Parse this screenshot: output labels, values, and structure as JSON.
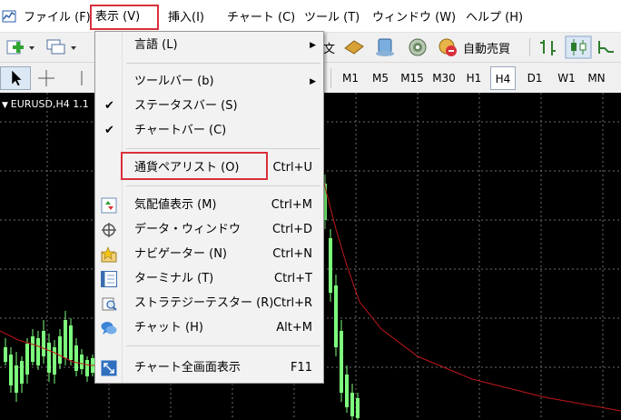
{
  "menubar": {
    "items": [
      "ファイル (F)",
      "表示 (V)",
      "挿入(I)",
      "チャート (C)",
      "ツール (T)",
      "ウィンドウ (W)",
      "ヘルプ (H)"
    ]
  },
  "toolbar1": {
    "text_label": "文",
    "auto_trading_label": "自動売買"
  },
  "timeframes": [
    "M1",
    "M5",
    "M15",
    "M30",
    "H1",
    "H4",
    "D1",
    "W1",
    "MN"
  ],
  "active_timeframe": "H4",
  "chart": {
    "title": "EURUSD,H4  1.1"
  },
  "view_menu": {
    "items": [
      {
        "label": "言語 (L)",
        "shortcut": "",
        "submenu": true,
        "checked": false,
        "icon": ""
      },
      {
        "label": "ツールバー (b)",
        "shortcut": "",
        "submenu": true,
        "checked": false,
        "icon": ""
      },
      {
        "label": "ステータスバー (S)",
        "shortcut": "",
        "submenu": false,
        "checked": true,
        "icon": ""
      },
      {
        "label": "チャートバー (C)",
        "shortcut": "",
        "submenu": false,
        "checked": true,
        "icon": ""
      },
      {
        "label": "通貨ペアリスト (O)",
        "shortcut": "Ctrl+U",
        "submenu": false,
        "checked": false,
        "icon": ""
      },
      {
        "label": "気配値表示 (M)",
        "shortcut": "Ctrl+M",
        "submenu": false,
        "checked": false,
        "icon": "market-watch-icon"
      },
      {
        "label": "データ・ウィンドウ",
        "shortcut": "Ctrl+D",
        "submenu": false,
        "checked": false,
        "icon": "crosshair-icon"
      },
      {
        "label": "ナビゲーター (N)",
        "shortcut": "Ctrl+N",
        "submenu": false,
        "checked": false,
        "icon": "navigator-star-icon"
      },
      {
        "label": "ターミナル (T)",
        "shortcut": "Ctrl+T",
        "submenu": false,
        "checked": false,
        "icon": "terminal-icon"
      },
      {
        "label": "ストラテジーテスター (R)",
        "shortcut": "Ctrl+R",
        "submenu": false,
        "checked": false,
        "icon": "strategy-tester-icon"
      },
      {
        "label": "チャット (H)",
        "shortcut": "Alt+M",
        "submenu": false,
        "checked": false,
        "icon": "chat-icon"
      },
      {
        "label": "チャート全画面表示",
        "shortcut": "F11",
        "submenu": false,
        "checked": false,
        "icon": "fullscreen-icon"
      }
    ]
  },
  "colors": {
    "highlight_border": "#d9303a",
    "chart_background": "#000000",
    "candle_color": "#7dff7d",
    "moving_average_color": "#c0181c",
    "grid_color": "#6e6e6e"
  }
}
